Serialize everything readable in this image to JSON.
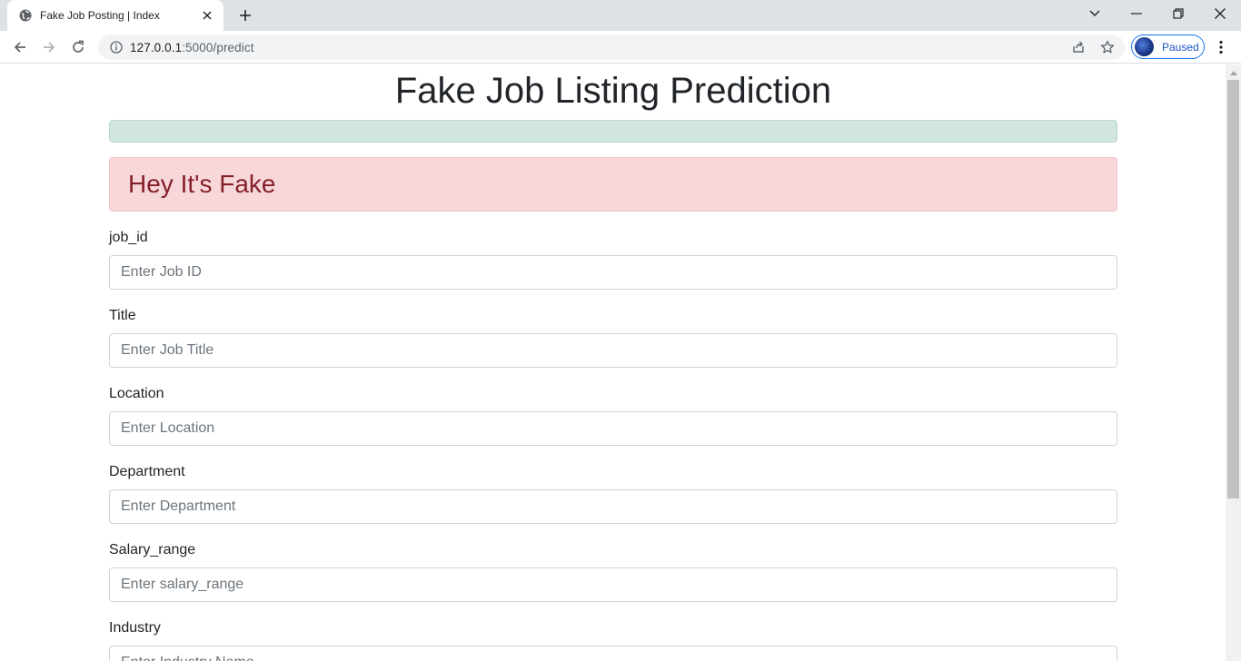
{
  "browser": {
    "tab_title": "Fake Job Posting | Index",
    "url_host": "127.0.0.1",
    "url_port_path": ":5000/predict",
    "profile_label": "Paused"
  },
  "page": {
    "title": "Fake Job Listing Prediction",
    "success_alert_text": "",
    "result_text": "Hey It's Fake"
  },
  "form": {
    "fields": [
      {
        "label": "job_id",
        "placeholder": "Enter Job ID",
        "value": ""
      },
      {
        "label": "Title",
        "placeholder": "Enter Job Title",
        "value": ""
      },
      {
        "label": "Location",
        "placeholder": "Enter Location",
        "value": ""
      },
      {
        "label": "Department",
        "placeholder": "Enter Department",
        "value": ""
      },
      {
        "label": "Salary_range",
        "placeholder": "Enter salary_range",
        "value": ""
      },
      {
        "label": "Industry",
        "placeholder": "Enter Industry Name",
        "value": ""
      }
    ]
  },
  "colors": {
    "success_bg": "#d1e7dd",
    "danger_bg": "#f8d7da",
    "danger_text": "#842029",
    "accent": "#1a73e8"
  }
}
